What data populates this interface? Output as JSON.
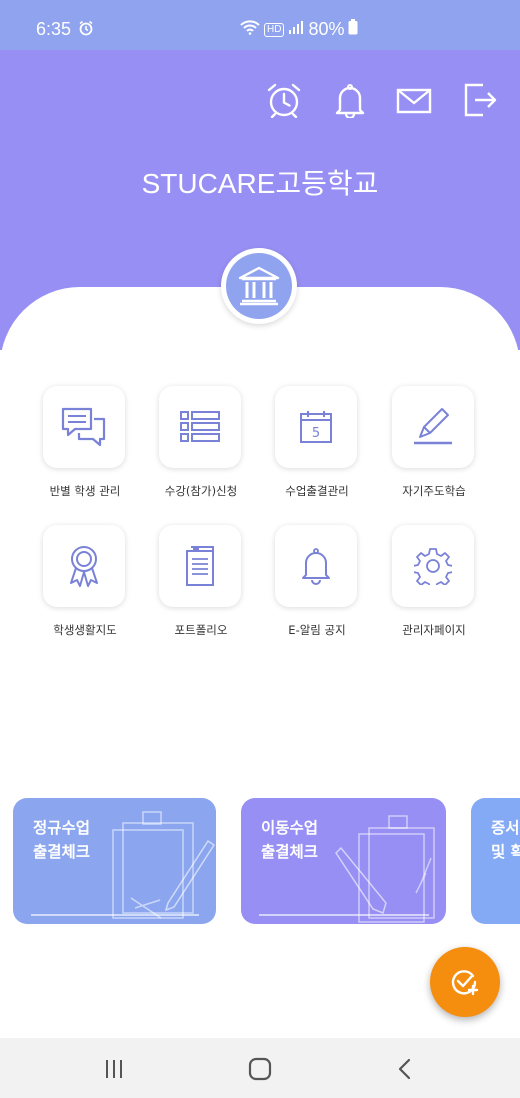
{
  "status_bar": {
    "time": "6:35",
    "battery": "80%",
    "hd_label": "HD"
  },
  "header": {
    "school_name": "STUCARE고등학교",
    "icons": [
      "alarm-clock-icon",
      "bell-icon",
      "mail-icon",
      "logout-icon"
    ],
    "background_color": "#978ff3"
  },
  "menu": {
    "items": [
      {
        "label": "반별 학생 관리",
        "icon": "chat-bubbles-icon"
      },
      {
        "label": "수강(참가)신청",
        "icon": "list-icon"
      },
      {
        "label": "수업출결관리",
        "icon": "calendar-icon"
      },
      {
        "label": "자기주도학습",
        "icon": "pencil-icon"
      },
      {
        "label": "학생생활지도",
        "icon": "award-ribbon-icon"
      },
      {
        "label": "포트폴리오",
        "icon": "clipboard-icon"
      },
      {
        "label": "E-알림 공지",
        "icon": "bell-icon"
      },
      {
        "label": "관리자페이지",
        "icon": "gear-icon"
      }
    ],
    "calendar_day": "5",
    "icon_color": "#7a82d8"
  },
  "cards": [
    {
      "line1": "정규수업",
      "line2": "출결체크",
      "color": "#8ba6ef"
    },
    {
      "line1": "이동수업",
      "line2": "출결체크",
      "color": "#978ff3"
    },
    {
      "line1": "증서",
      "line2": "및 확",
      "color": "#84aaf5"
    }
  ],
  "fab": {
    "icon": "check-add-icon",
    "color": "#f58e0f"
  },
  "navbar": {
    "icons": [
      "recent-apps-icon",
      "home-icon",
      "back-icon"
    ]
  }
}
